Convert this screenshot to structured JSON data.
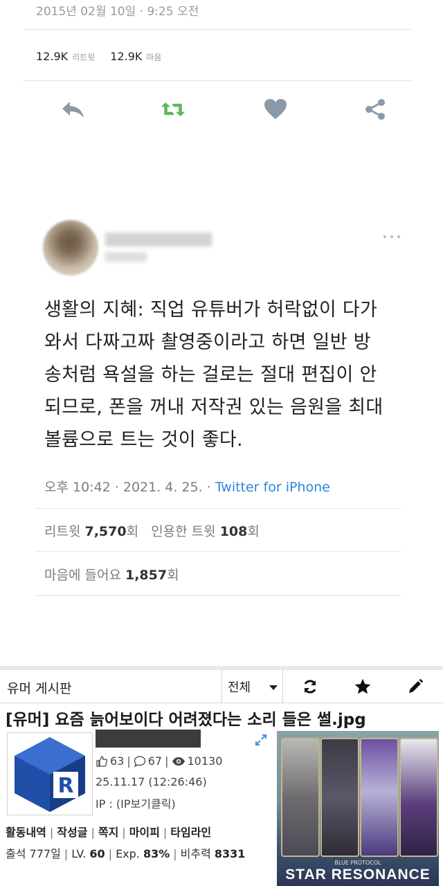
{
  "tweet1": {
    "timestamp": "2015년 02월 10일 · 9:25 오전",
    "retweets": {
      "count": "12.9K",
      "label": "리트윗"
    },
    "likes": {
      "count": "12.9K",
      "label": "마음"
    },
    "colors": {
      "icon": "#8a99a8",
      "retweet_active": "#5cb85c"
    }
  },
  "tweet2": {
    "text_lines": [
      "생활의 지혜: 직업 유튜버가 허락없이 다가",
      "와서 다짜고짜 촬영중이라고 하면 일반 방",
      "송처럼 욕설을 하는 걸로는 절대 편집이 안",
      "되므로, 폰을 꺼내 저작권 있는 음원을 최대",
      "볼륨으로 트는 것이 좋다."
    ],
    "time": "오후 10:42 · 2021. 4. 25. · ",
    "source": "Twitter for iPhone",
    "retweet_label": "리트윗 ",
    "retweet_count": "7,570",
    "retweet_unit": "회",
    "quote_label": "인용한 트윗 ",
    "quote_count": "108",
    "quote_unit": "회",
    "likes_label": "마음에 들어요 ",
    "likes_count": "1,857",
    "likes_unit": "회"
  },
  "forum": {
    "board_name": "유머 게시판",
    "filter_selected": "전체",
    "post_title": "[유머] 요즘 늙어보이다 어려졌다는 소리 들은 썰.jpg",
    "likes": "63",
    "comments": "67",
    "views": "10130",
    "date": "25.11.17 (12:26:46)",
    "ip": "IP : (IP보기클릭)",
    "profile_links": [
      "활동내역",
      "작성글",
      "쪽지",
      "마이피",
      "타임라인"
    ],
    "attendance_label": "출석 ",
    "attendance_value": "777일",
    "level_label": "LV. ",
    "level_value": "60",
    "exp_label": "Exp. ",
    "exp_value": "83%",
    "power_label": "비추력 ",
    "power_value": "8331",
    "thumbnail_caption": "STAR RESONANCE",
    "thumbnail_subcaption": "BLUE PROTOCOL",
    "colors": {
      "logo_blue": "#1f4fa8",
      "divider": "#e9e9e9"
    }
  }
}
